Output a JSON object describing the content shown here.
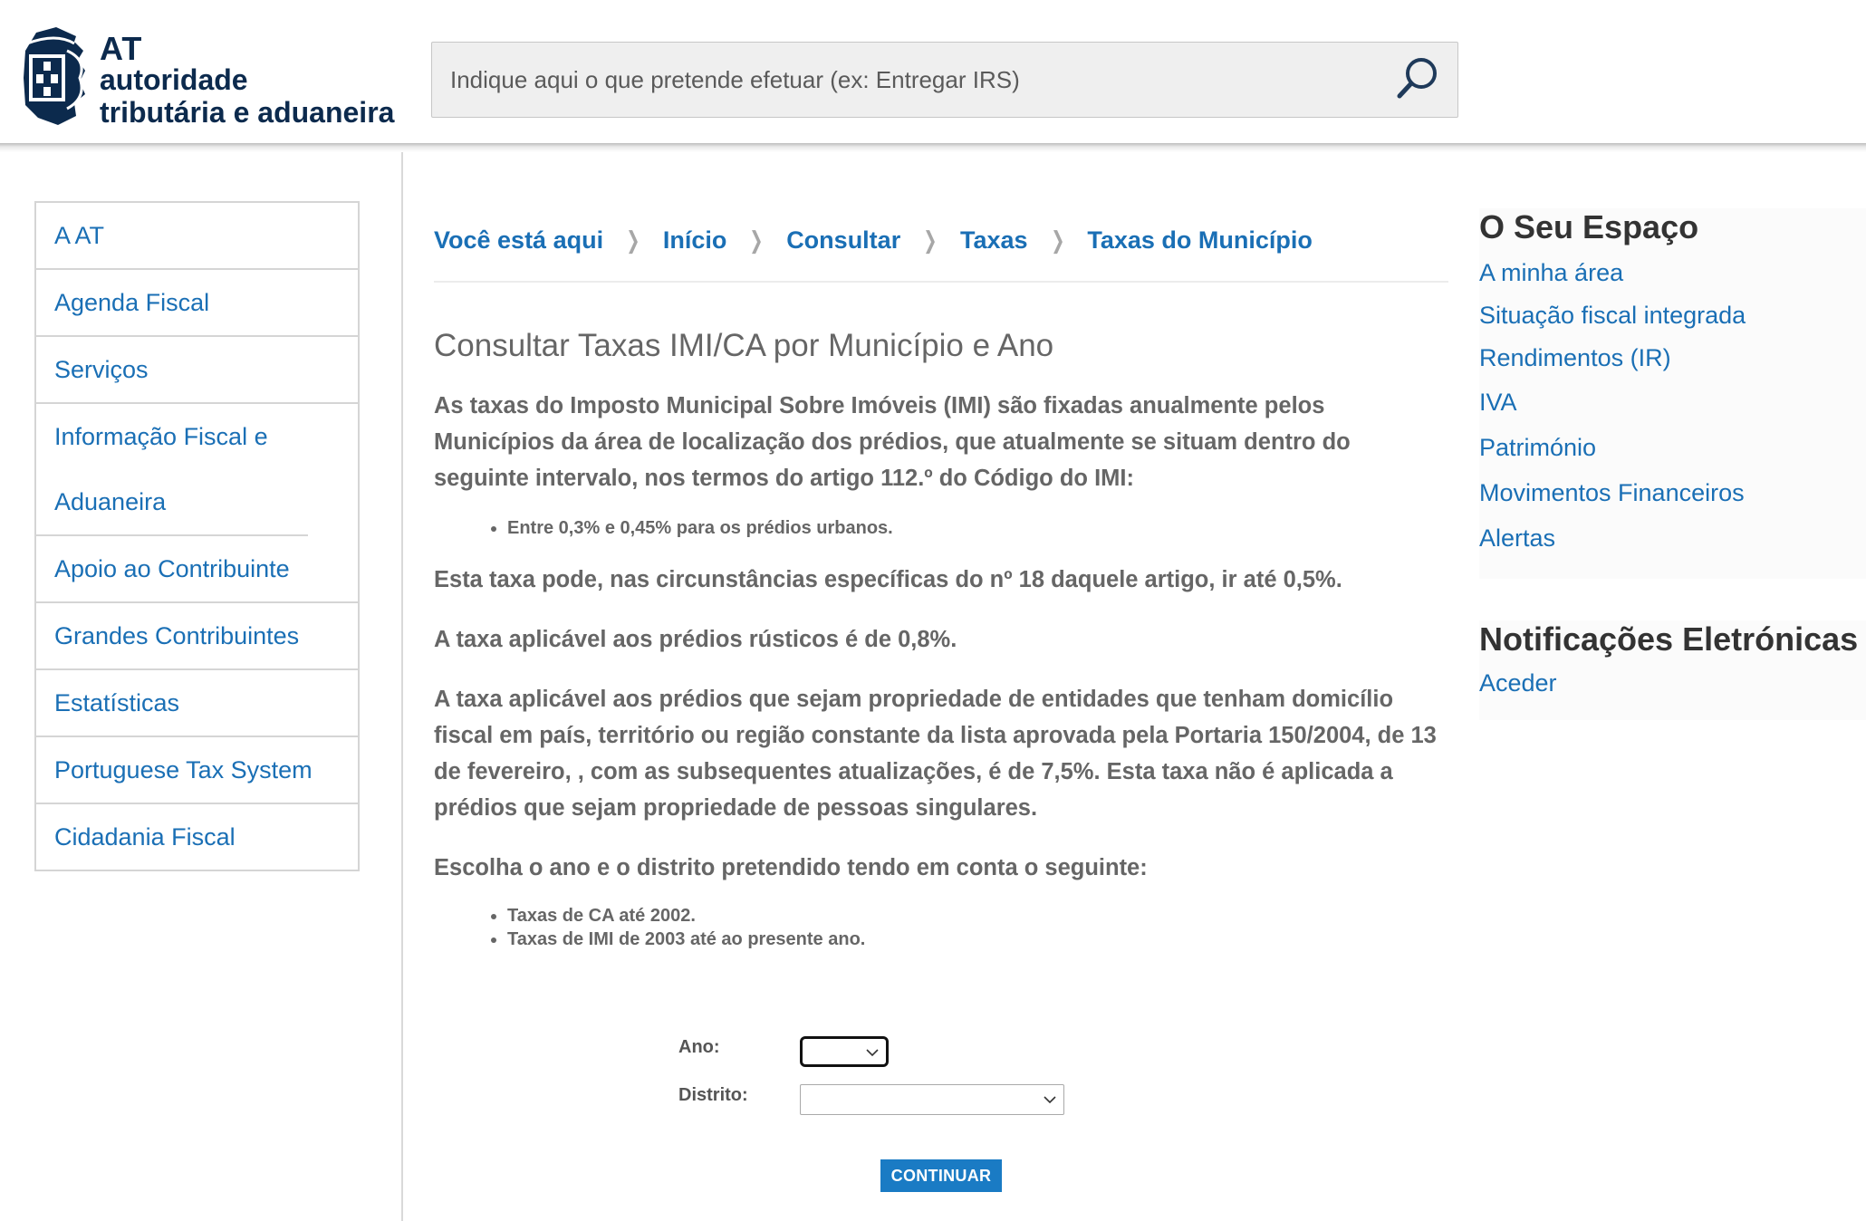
{
  "header": {
    "logo": {
      "line1": "AT",
      "line2": "autoridade",
      "line3": "tributária e aduaneira"
    },
    "search": {
      "placeholder": "Indique aqui o que pretende efetuar (ex: Entregar IRS)",
      "icon": "search-icon"
    }
  },
  "left_nav": {
    "items": [
      {
        "label": "A AT"
      },
      {
        "label": "Agenda Fiscal"
      },
      {
        "label": "Serviços"
      },
      {
        "label": "Informação Fiscal e Aduaneira"
      },
      {
        "label": "Apoio ao Contribuinte"
      },
      {
        "label": "Grandes Contribuintes"
      },
      {
        "label": "Estatísticas"
      },
      {
        "label": "Portuguese Tax System"
      },
      {
        "label": "Cidadania Fiscal"
      }
    ]
  },
  "breadcrumb": {
    "items": [
      "Você está aqui",
      "Início",
      "Consultar",
      "Taxas",
      "Taxas do Município"
    ]
  },
  "main": {
    "title": "Consultar Taxas IMI/CA por Município e Ano",
    "p1": "As taxas do Imposto Municipal Sobre Imóveis (IMI) são fixadas anualmente pelos Municípios da área de localização dos prédios, que atualmente se situam dentro do seguinte intervalo, nos termos do artigo 112.º do Código do IMI:",
    "bullets1": [
      "Entre 0,3% e 0,45% para os prédios urbanos."
    ],
    "p2": "Esta taxa pode, nas circunstâncias específicas do nº 18 daquele artigo, ir até 0,5%.",
    "p3": "A taxa aplicável aos prédios rústicos é de 0,8%.",
    "p4": "A taxa aplicável aos prédios que sejam propriedade de entidades que tenham domicílio fiscal em país, território ou região constante da lista aprovada pela Portaria 150/2004, de 13 de fevereiro, , com as subsequentes atualizações, é de 7,5%. Esta taxa não é aplicada a prédios que sejam propriedade de pessoas singulares.",
    "p5": "Escolha o ano e o distrito pretendido tendo em conta o seguinte:",
    "bullets2": [
      "Taxas de CA até 2002.",
      "Taxas de IMI de 2003 até ao presente ano."
    ]
  },
  "form": {
    "ano_label": "Ano:",
    "ano_value": "",
    "distrito_label": "Distrito:",
    "distrito_value": "",
    "submit_label": "CONTINUAR"
  },
  "right_bar": {
    "seu_espaco": {
      "title": "O Seu Espaço",
      "links": [
        "A minha área",
        "Situação fiscal integrada",
        "Rendimentos (IR)",
        "IVA",
        "Património",
        "Movimentos Financeiros",
        "Alertas"
      ]
    },
    "notificacoes": {
      "title": "Notificações Eletrónicas",
      "links": [
        "Aceder"
      ]
    }
  },
  "colors": {
    "link_blue": "#1a6fb5",
    "logo_navy": "#0c2a4d",
    "button_blue": "#1a7bc4",
    "body_text": "#666666"
  }
}
